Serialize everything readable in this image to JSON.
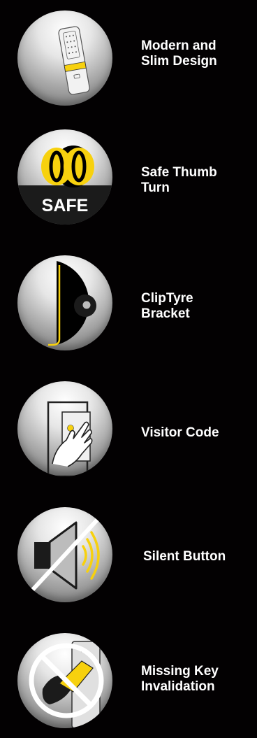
{
  "features": [
    {
      "label": "Modern and\nSlim Design",
      "icon": "keypad-lock-icon"
    },
    {
      "label": "Safe Thumb\nTurn",
      "icon": "safe-thumb-turn-icon",
      "badge_text": "SAFE"
    },
    {
      "label": "ClipTyre\nBracket",
      "icon": "cliptyre-bracket-icon"
    },
    {
      "label": "Visitor Code",
      "icon": "hand-touch-icon"
    },
    {
      "label": "Silent Button",
      "icon": "mute-speaker-icon"
    },
    {
      "label": "Missing Key\nInvalidation",
      "icon": "no-key-card-icon"
    }
  ],
  "colors": {
    "background": "#030102",
    "accent": "#f7d10e",
    "text": "#ffffff"
  }
}
